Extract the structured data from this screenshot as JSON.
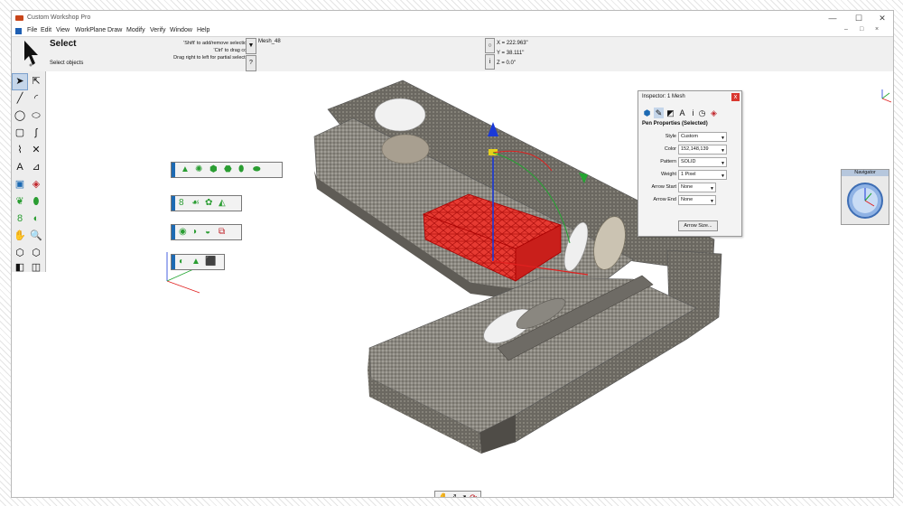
{
  "window": {
    "title": "Custom Workshop Pro",
    "controls": [
      "—",
      "☐",
      "✕"
    ]
  },
  "menu": {
    "items": [
      "File",
      "Edit",
      "View",
      "WorkPlane",
      "Draw",
      "Modify",
      "Verify",
      "Window",
      "Help"
    ],
    "controls": [
      "–",
      "□",
      "×"
    ]
  },
  "mode_bar": {
    "title": "Select",
    "description": "Select objects",
    "hints": [
      "'Shift' to add/remove selections",
      "'Ctrl' to drag copy",
      "Drag right to left for partial selection"
    ],
    "hint_button": "?",
    "dropdown_button": "▼",
    "object_name": "Mesh_48",
    "coord_x": "X = 222.963\"",
    "coord_y": "Y = 38.111\"",
    "coord_z": "Z = 0.0\"",
    "coord_button_top": "○",
    "coord_button_bottom": "i"
  },
  "toolbox": {
    "icons": [
      "arrow",
      "direct",
      "line",
      "arc",
      "circle",
      "ellipse",
      "rect",
      "curve",
      "polyline",
      "scissor",
      "text",
      "dimension",
      "mesh",
      "gear",
      "sphere",
      "chain",
      "pan",
      "zoom",
      "cube",
      "cube2",
      "cube3",
      "cube4"
    ]
  },
  "inspector": {
    "title": "Inspector: 1 Mesh",
    "close": "x",
    "heading": "Pen Properties (Selected)",
    "rows": [
      {
        "label": "Style",
        "value": "Custom"
      },
      {
        "label": "Color",
        "value": "152,148,139"
      },
      {
        "label": "Pattern",
        "value": "SOLID"
      },
      {
        "label": "Weight",
        "value": "1 Pixel"
      },
      {
        "label": "Arrow Start",
        "value": "None"
      },
      {
        "label": "Arrow End",
        "value": "None"
      }
    ],
    "arrow_size_button": "Arrow Size..."
  },
  "navigator": {
    "title": "Navigator"
  },
  "colors": {
    "selection": "#e0201f",
    "sofa": "#8b8880",
    "gizmo_up": "#1a39d8",
    "gizmo_green": "#23a531",
    "palette_grip": "#1d6ab3"
  }
}
